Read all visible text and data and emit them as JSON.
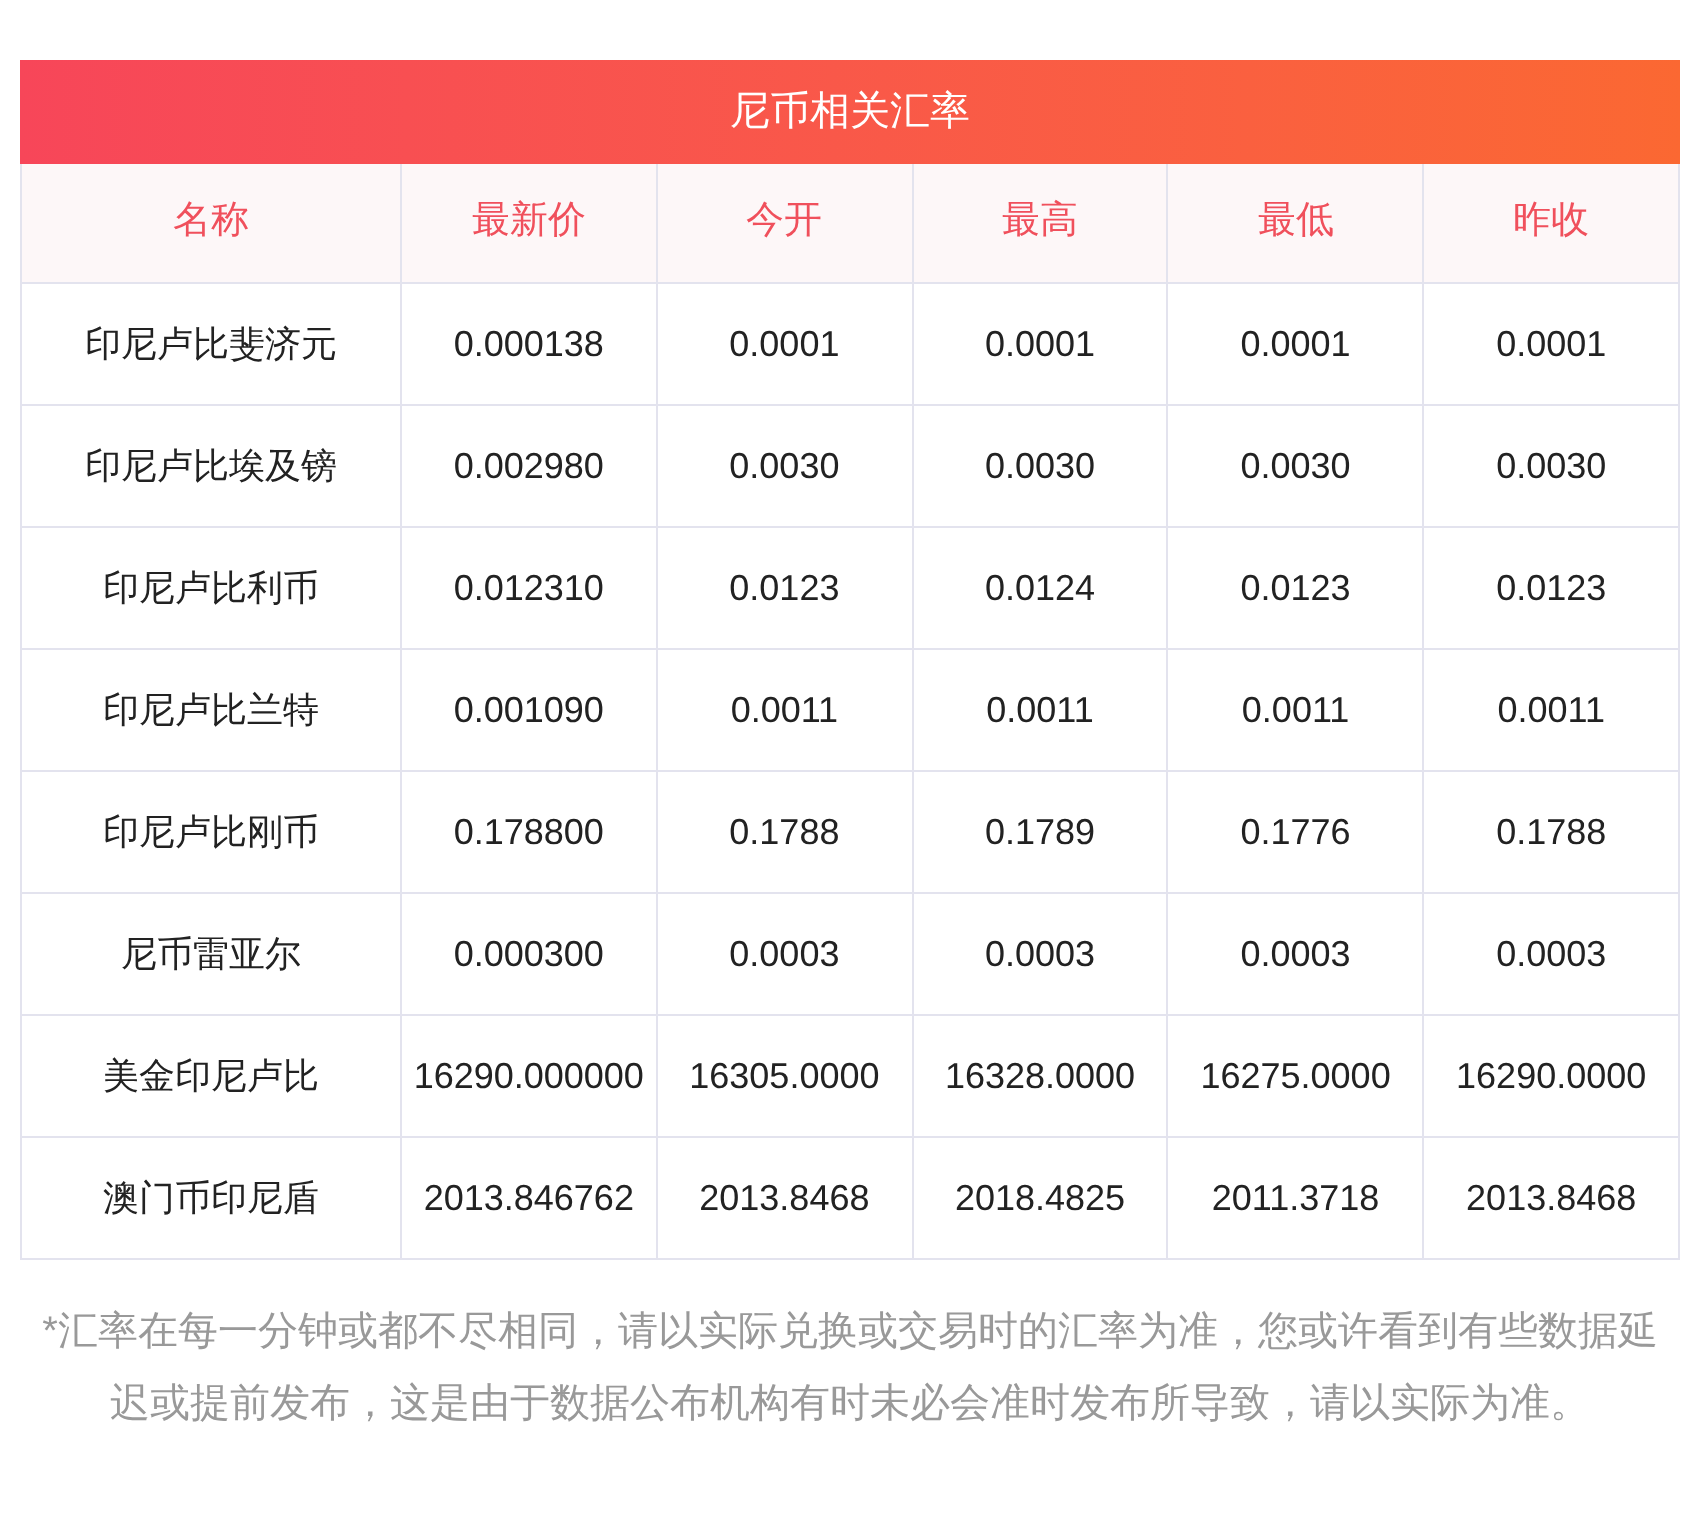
{
  "title": "尼币相关汇率",
  "columns": [
    "名称",
    "最新价",
    "今开",
    "最高",
    "最低",
    "昨收"
  ],
  "rows": [
    [
      "印尼卢比斐济元",
      "0.000138",
      "0.0001",
      "0.0001",
      "0.0001",
      "0.0001"
    ],
    [
      "印尼卢比埃及镑",
      "0.002980",
      "0.0030",
      "0.0030",
      "0.0030",
      "0.0030"
    ],
    [
      "印尼卢比利币",
      "0.012310",
      "0.0123",
      "0.0124",
      "0.0123",
      "0.0123"
    ],
    [
      "印尼卢比兰特",
      "0.001090",
      "0.0011",
      "0.0011",
      "0.0011",
      "0.0011"
    ],
    [
      "印尼卢比刚币",
      "0.178800",
      "0.1788",
      "0.1789",
      "0.1776",
      "0.1788"
    ],
    [
      "尼币雷亚尔",
      "0.000300",
      "0.0003",
      "0.0003",
      "0.0003",
      "0.0003"
    ],
    [
      "美金印尼卢比",
      "16290.000000",
      "16305.0000",
      "16328.0000",
      "16275.0000",
      "16290.0000"
    ],
    [
      "澳门币印尼盾",
      "2013.846762",
      "2013.8468",
      "2018.4825",
      "2011.3718",
      "2013.8468"
    ]
  ],
  "note": "*汇率在每一分钟或都不尽相同，请以实际兑换或交易时的汇率为准，您或许看到有些数据延迟或提前发布，这是由于数据公布机构有时未必会准时发布所导致，请以实际为准。"
}
